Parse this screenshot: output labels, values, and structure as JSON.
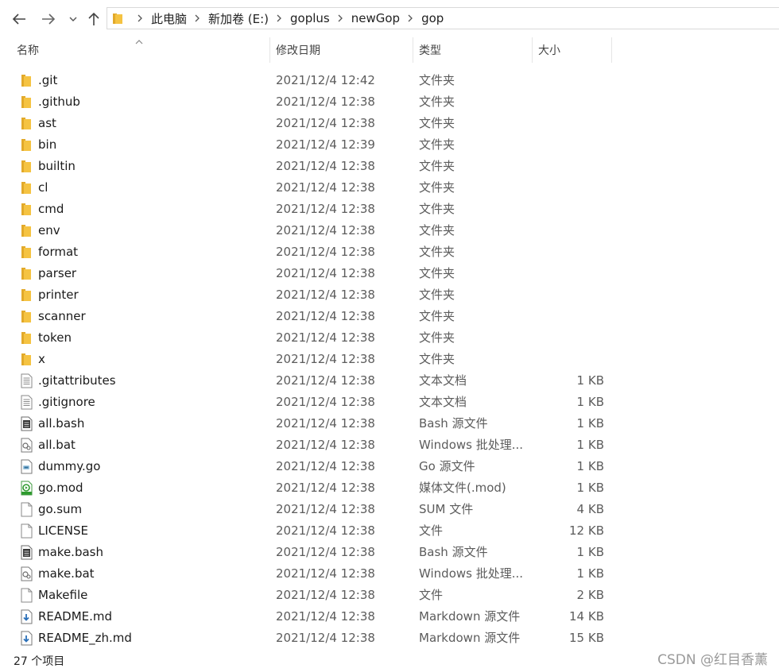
{
  "navigation": {
    "breadcrumbs": [
      "此电脑",
      "新加卷 (E:)",
      "goplus",
      "newGop",
      "gop"
    ]
  },
  "columns": {
    "name": "名称",
    "date": "修改日期",
    "type": "类型",
    "size": "大小"
  },
  "files": [
    {
      "name": ".git",
      "date": "2021/12/4 12:42",
      "type": "文件夹",
      "size": "",
      "icon": "folder-icon"
    },
    {
      "name": ".github",
      "date": "2021/12/4 12:38",
      "type": "文件夹",
      "size": "",
      "icon": "folder-icon"
    },
    {
      "name": "ast",
      "date": "2021/12/4 12:38",
      "type": "文件夹",
      "size": "",
      "icon": "folder-icon"
    },
    {
      "name": "bin",
      "date": "2021/12/4 12:39",
      "type": "文件夹",
      "size": "",
      "icon": "folder-icon"
    },
    {
      "name": "builtin",
      "date": "2021/12/4 12:38",
      "type": "文件夹",
      "size": "",
      "icon": "folder-icon"
    },
    {
      "name": "cl",
      "date": "2021/12/4 12:38",
      "type": "文件夹",
      "size": "",
      "icon": "folder-icon"
    },
    {
      "name": "cmd",
      "date": "2021/12/4 12:38",
      "type": "文件夹",
      "size": "",
      "icon": "folder-icon"
    },
    {
      "name": "env",
      "date": "2021/12/4 12:38",
      "type": "文件夹",
      "size": "",
      "icon": "folder-icon"
    },
    {
      "name": "format",
      "date": "2021/12/4 12:38",
      "type": "文件夹",
      "size": "",
      "icon": "folder-icon"
    },
    {
      "name": "parser",
      "date": "2021/12/4 12:38",
      "type": "文件夹",
      "size": "",
      "icon": "folder-icon"
    },
    {
      "name": "printer",
      "date": "2021/12/4 12:38",
      "type": "文件夹",
      "size": "",
      "icon": "folder-icon"
    },
    {
      "name": "scanner",
      "date": "2021/12/4 12:38",
      "type": "文件夹",
      "size": "",
      "icon": "folder-icon"
    },
    {
      "name": "token",
      "date": "2021/12/4 12:38",
      "type": "文件夹",
      "size": "",
      "icon": "folder-icon"
    },
    {
      "name": "x",
      "date": "2021/12/4 12:38",
      "type": "文件夹",
      "size": "",
      "icon": "folder-icon"
    },
    {
      "name": ".gitattributes",
      "date": "2021/12/4 12:38",
      "type": "文本文档",
      "size": "1 KB",
      "icon": "text-document-icon"
    },
    {
      "name": ".gitignore",
      "date": "2021/12/4 12:38",
      "type": "文本文档",
      "size": "1 KB",
      "icon": "text-document-icon"
    },
    {
      "name": "all.bash",
      "date": "2021/12/4 12:38",
      "type": "Bash 源文件",
      "size": "1 KB",
      "icon": "bash-file-icon"
    },
    {
      "name": "all.bat",
      "date": "2021/12/4 12:38",
      "type": "Windows 批处理...",
      "size": "1 KB",
      "icon": "batch-file-icon"
    },
    {
      "name": "dummy.go",
      "date": "2021/12/4 12:38",
      "type": "Go 源文件",
      "size": "1 KB",
      "icon": "go-file-icon"
    },
    {
      "name": "go.mod",
      "date": "2021/12/4 12:38",
      "type": "媒体文件(.mod)",
      "size": "1 KB",
      "icon": "media-file-icon"
    },
    {
      "name": "go.sum",
      "date": "2021/12/4 12:38",
      "type": "SUM 文件",
      "size": "4 KB",
      "icon": "blank-file-icon"
    },
    {
      "name": "LICENSE",
      "date": "2021/12/4 12:38",
      "type": "文件",
      "size": "12 KB",
      "icon": "blank-file-icon"
    },
    {
      "name": "make.bash",
      "date": "2021/12/4 12:38",
      "type": "Bash 源文件",
      "size": "1 KB",
      "icon": "bash-file-icon"
    },
    {
      "name": "make.bat",
      "date": "2021/12/4 12:38",
      "type": "Windows 批处理...",
      "size": "1 KB",
      "icon": "batch-file-icon"
    },
    {
      "name": "Makefile",
      "date": "2021/12/4 12:38",
      "type": "文件",
      "size": "2 KB",
      "icon": "blank-file-icon"
    },
    {
      "name": "README.md",
      "date": "2021/12/4 12:38",
      "type": "Markdown 源文件",
      "size": "14 KB",
      "icon": "markdown-file-icon"
    },
    {
      "name": "README_zh.md",
      "date": "2021/12/4 12:38",
      "type": "Markdown 源文件",
      "size": "15 KB",
      "icon": "markdown-file-icon"
    }
  ],
  "status": {
    "item_count": "27 个项目"
  },
  "watermark": "CSDN @红目香薰",
  "colors": {
    "folder": "#f5c342",
    "folder_dark": "#e2a92a",
    "text_secondary": "#5c5c5c"
  }
}
